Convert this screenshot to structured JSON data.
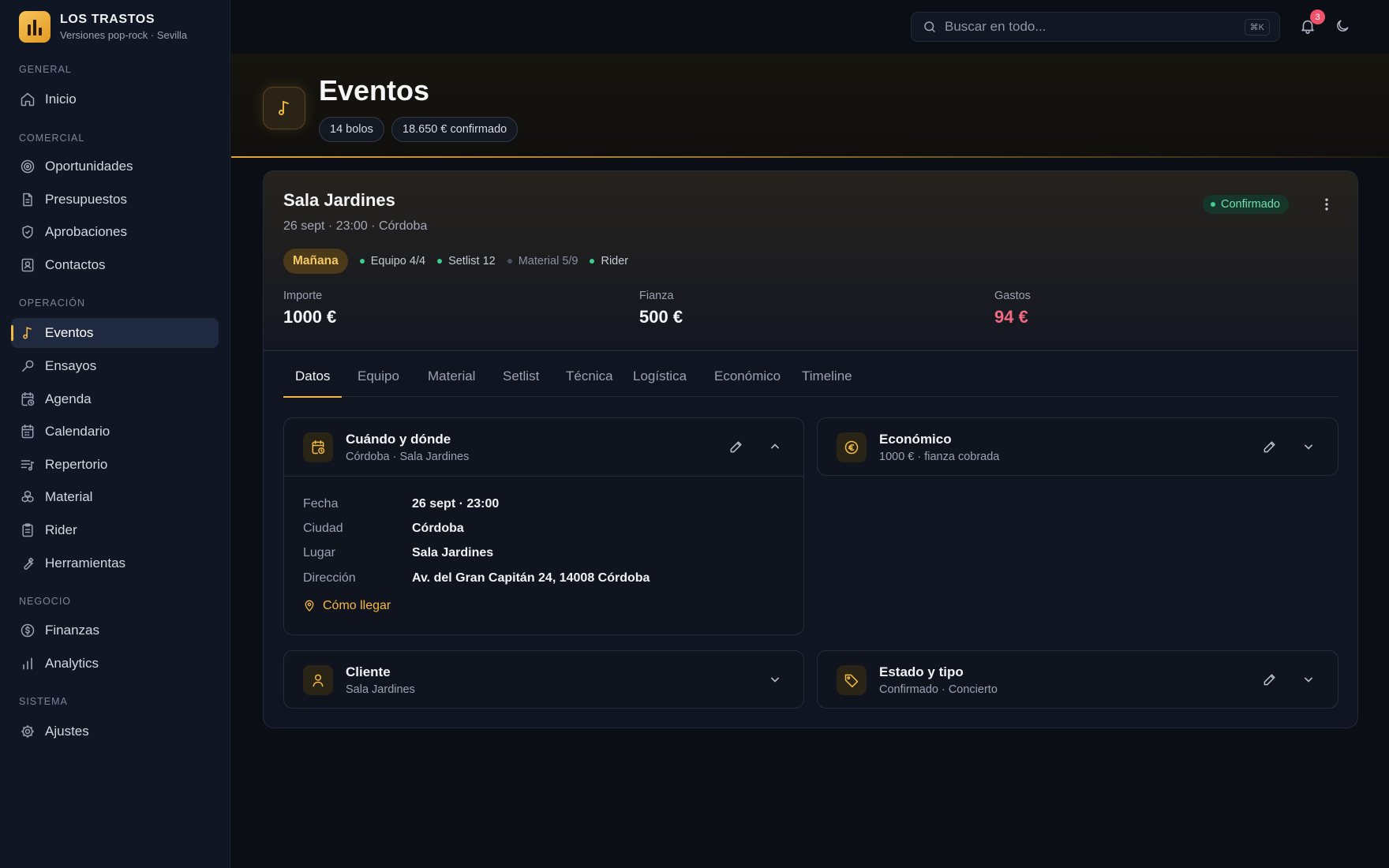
{
  "brand": {
    "name": "LOS TRASTOS",
    "subtitle": "Versiones pop-rock · Sevilla"
  },
  "sidebar": {
    "sections": [
      {
        "label": "GENERAL"
      },
      {
        "label": "COMERCIAL"
      },
      {
        "label": "OPERACIÓN"
      },
      {
        "label": "NEGOCIO"
      },
      {
        "label": "SISTEMA"
      }
    ],
    "items": [
      {
        "label": "Inicio",
        "icon": "home-icon"
      },
      {
        "label": "Oportunidades",
        "icon": "target-icon"
      },
      {
        "label": "Presupuestos",
        "icon": "document-icon"
      },
      {
        "label": "Aprobaciones",
        "icon": "shield-check-icon"
      },
      {
        "label": "Contactos",
        "icon": "contact-card-icon"
      },
      {
        "label": "Eventos",
        "icon": "music-note-icon",
        "active": true
      },
      {
        "label": "Ensayos",
        "icon": "microphone-icon"
      },
      {
        "label": "Agenda",
        "icon": "calendar-clock-icon"
      },
      {
        "label": "Calendario",
        "icon": "calendar-icon"
      },
      {
        "label": "Repertorio",
        "icon": "music-list-icon"
      },
      {
        "label": "Material",
        "icon": "boxes-icon"
      },
      {
        "label": "Rider",
        "icon": "clipboard-icon"
      },
      {
        "label": "Herramientas",
        "icon": "wrench-icon"
      },
      {
        "label": "Finanzas",
        "icon": "dollar-circle-icon"
      },
      {
        "label": "Analytics",
        "icon": "bar-chart-icon"
      },
      {
        "label": "Ajustes",
        "icon": "gear-icon"
      }
    ]
  },
  "topbar": {
    "search_placeholder": "Buscar en todo...",
    "shortcut": "⌘K",
    "notifications_count": "3"
  },
  "page": {
    "title": "Eventos",
    "pills": [
      "14 bolos",
      "18.650 € confirmado"
    ]
  },
  "event": {
    "title": "Sala Jardines",
    "meta": "26 sept · 23:00 · Córdoba",
    "status": "Confirmado",
    "highlight_tag": "Mañana",
    "tags": [
      {
        "label": "Equipo 4/4",
        "color": "#3ecf8e"
      },
      {
        "label": "Setlist 12",
        "color": "#3ecf8e"
      },
      {
        "label": "Material 5/9",
        "color": "#4a5160"
      },
      {
        "label": "Rider",
        "color": "#3ecf8e"
      }
    ],
    "metrics": [
      {
        "label": "Importe",
        "value": "1000 €"
      },
      {
        "label": "Fianza",
        "value": "500 €"
      },
      {
        "label": "Gastos",
        "value": "94 €"
      }
    ],
    "tabs": [
      "Datos",
      "Equipo",
      "Material",
      "Setlist",
      "Técnica",
      "Logística",
      "Económico",
      "Timeline"
    ],
    "active_tab": "Datos"
  },
  "panels": {
    "when_where": {
      "title": "Cuándo y dónde",
      "subtitle": "Córdoba · Sala Jardines",
      "fields": [
        {
          "label": "Fecha",
          "value": "26 sept · 23:00"
        },
        {
          "label": "Ciudad",
          "value": "Córdoba"
        },
        {
          "label": "Lugar",
          "value": "Sala Jardines"
        },
        {
          "label": "Dirección",
          "value": "Av. del Gran Capitán 24, 14008 Córdoba"
        }
      ],
      "link": "Cómo llegar"
    },
    "economic": {
      "title": "Económico",
      "subtitle": "1000 € · fianza cobrada"
    },
    "client": {
      "title": "Cliente",
      "subtitle": "Sala Jardines"
    },
    "status_type": {
      "title": "Estado y tipo",
      "subtitle": "Confirmado · Concierto"
    }
  },
  "colors": {
    "accent": "#f4b942",
    "success": "#3ecf8e",
    "danger": "#f16a82",
    "background": "#0b0e15"
  }
}
